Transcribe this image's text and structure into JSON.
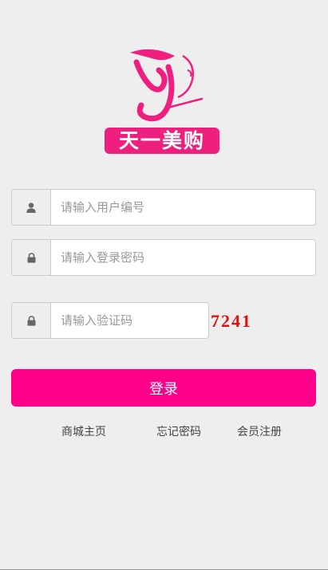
{
  "brand": {
    "logo_letter": "Y",
    "name": "天一美购",
    "color": "#ee1f7f"
  },
  "form": {
    "username": {
      "placeholder": "请输入用户编号",
      "value": "",
      "icon": "user-icon"
    },
    "password": {
      "placeholder": "请输入登录密码",
      "value": "",
      "icon": "lock-icon"
    },
    "captcha": {
      "placeholder": "请输入验证码",
      "value": "",
      "icon": "lock-icon",
      "image_text": "7241"
    }
  },
  "login_button": {
    "label": "登录",
    "color": "#ff0088"
  },
  "links": {
    "home": "商城主页",
    "forgot": "忘记密码",
    "register": "会员注册"
  },
  "colors": {
    "background": "#eeeeee",
    "captcha_text": "#dd1111"
  }
}
